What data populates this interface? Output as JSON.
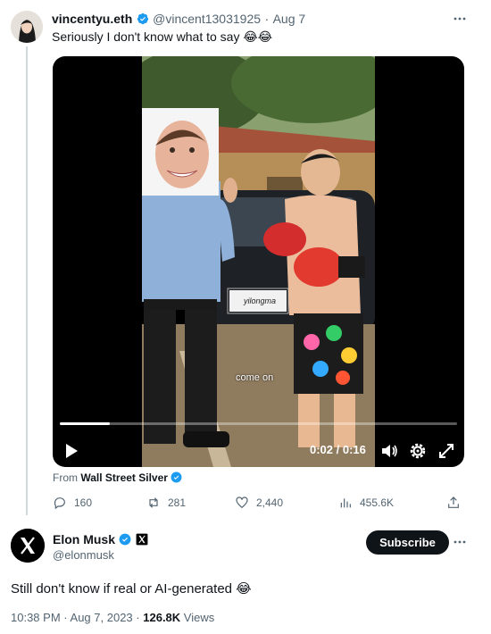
{
  "quoted": {
    "display_name": "vincentyu.eth",
    "handle": "@vincent13031925",
    "date": "Aug 7",
    "separator": "·",
    "text": "Seriously I don't know what to say 😂😂",
    "video": {
      "face_card_label": "yilongma",
      "caption": "come on",
      "time_display": "0:02 / 0:16",
      "progress": 0.125
    },
    "from_prefix": "From",
    "from_source": "Wall Street Silver",
    "stats": {
      "replies": "160",
      "reposts": "281",
      "likes": "2,440",
      "views": "455.6K"
    }
  },
  "main": {
    "display_name": "Elon Musk",
    "handle": "@elonmusk",
    "subscribe_label": "Subscribe",
    "text": "Still don't know if real or AI-generated 😂",
    "time": "10:38 PM",
    "date": "Aug 7, 2023",
    "views_count": "126.8K",
    "views_label": "Views",
    "separator": "·"
  },
  "colors": {
    "verified_blue": "#1d9bf0",
    "muted_text": "#536471",
    "thread_line": "#cfd9de",
    "subscribe_bg": "#0f1419"
  }
}
